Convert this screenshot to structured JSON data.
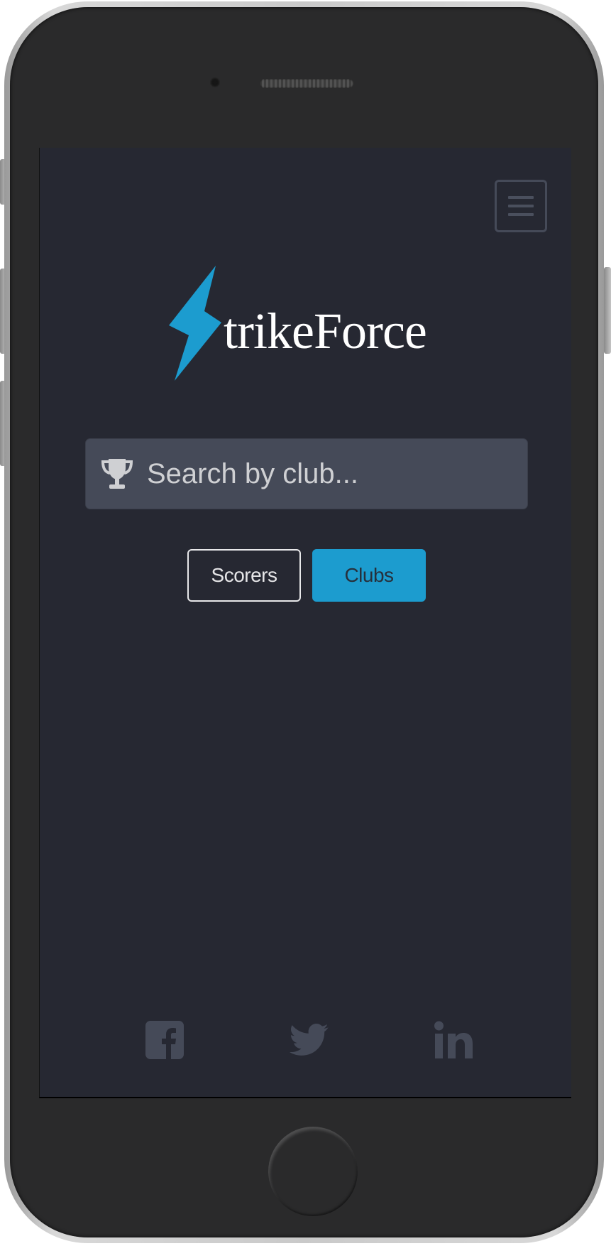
{
  "app": {
    "brand_name": "trikeForce",
    "accent_color": "#1c9ccf",
    "background_color": "#262832"
  },
  "header": {
    "menu_icon": "hamburger-icon"
  },
  "search": {
    "icon": "trophy-icon",
    "placeholder": "Search by club..."
  },
  "mode_toggle": {
    "options": [
      {
        "label": "Scorers",
        "active": false
      },
      {
        "label": "Clubs",
        "active": true
      }
    ]
  },
  "footer": {
    "social_links": [
      {
        "icon": "facebook-icon"
      },
      {
        "icon": "twitter-icon"
      },
      {
        "icon": "linkedin-icon"
      }
    ]
  }
}
